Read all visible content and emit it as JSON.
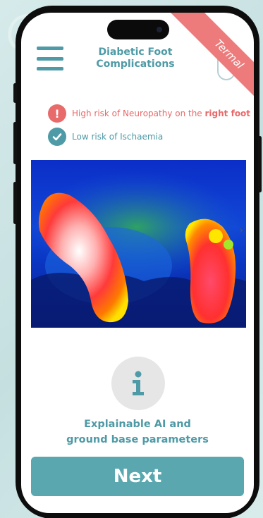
{
  "header": {
    "title_line1": "Diabetic Foot",
    "title_line2": "Complications",
    "ribbon": "Termal"
  },
  "alerts": [
    {
      "icon": "exclamation-icon",
      "text": "High risk of Neuropathy on the ",
      "emphasis": "right foot",
      "color": "#e86a6a"
    },
    {
      "icon": "check-icon",
      "text": "Low risk of Ischaemia",
      "color": "#4e9aa6"
    }
  ],
  "thermal_image": {
    "description_icon": "chevron-right-icon"
  },
  "info": {
    "icon": "info-icon",
    "line1": "Explainable AI and",
    "line2": "ground base parameters"
  },
  "next_button": {
    "label": "Next"
  },
  "colors": {
    "accent": "#4e9aa6",
    "alert": "#e86a6a",
    "button": "#5aa7b0",
    "ribbon": "#ee7b7b"
  }
}
